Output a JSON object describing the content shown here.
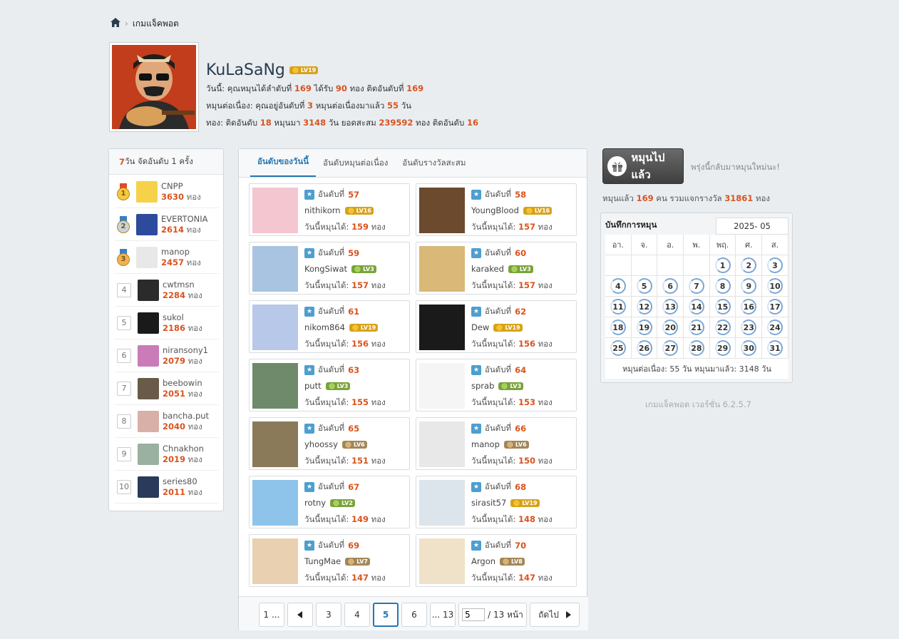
{
  "breadcrumb": {
    "current": "เกมแจ็คพอต"
  },
  "profile": {
    "name": "KuLaSaNg",
    "level": "LV19",
    "line1": {
      "a": "วันนี้: คุณหมุนได้ลำดับที่ ",
      "rank": "169",
      "b": " ได้รับ ",
      "gold": "90",
      "c": " ทอง ติดอันดับที่ ",
      "pos": "169"
    },
    "line2": {
      "a": "หมุนต่อเนื่อง: คุณอยู่อันดับที่ ",
      "rank": "3",
      "b": " หมุนต่อเนื่องมาแล้ว ",
      "days": "55",
      "c": " วัน"
    },
    "line3": {
      "a": "ทอง: ติดอันดับ ",
      "rank": "18",
      "b": " หมุนมา ",
      "days": "3148",
      "c": " วัน ยอดสะสม ",
      "total": "239592",
      "d": " ทอง ติดอันดับ ",
      "pos": "16"
    }
  },
  "weekly": {
    "header_num": "7",
    "header_text": " วัน จัดอันดับ 1 ครั้ง",
    "unit": "ทอง",
    "items": [
      {
        "rank": "1",
        "name": "CNPP",
        "score": "3630"
      },
      {
        "rank": "2",
        "name": "EVERTONIA",
        "score": "2614"
      },
      {
        "rank": "3",
        "name": "manop",
        "score": "2457"
      },
      {
        "rank": "4",
        "name": "cwtmsn",
        "score": "2284"
      },
      {
        "rank": "5",
        "name": "sukol",
        "score": "2186"
      },
      {
        "rank": "6",
        "name": "niransony1",
        "score": "2079"
      },
      {
        "rank": "7",
        "name": "beebowin",
        "score": "2051"
      },
      {
        "rank": "8",
        "name": "bancha.put",
        "score": "2040"
      },
      {
        "rank": "9",
        "name": "Chnakhon",
        "score": "2019"
      },
      {
        "rank": "10",
        "name": "series80",
        "score": "2011"
      }
    ]
  },
  "tabs": [
    "อันดับของวันนี้",
    "อันดับหมุนต่อเนื่อง",
    "อันดับรางวัลสะสม"
  ],
  "card_labels": {
    "rank_prefix": "อันดับที่ ",
    "spin_prefix": "วันนี้หมุนได้: ",
    "unit": " ทอง"
  },
  "cards": [
    {
      "rank": "57",
      "name": "nithikorn",
      "level": "LV16",
      "gold": "159"
    },
    {
      "rank": "58",
      "name": "YoungBlood",
      "level": "LV16",
      "gold": "157"
    },
    {
      "rank": "59",
      "name": "KongSiwat",
      "level": "LV3",
      "gold": "157"
    },
    {
      "rank": "60",
      "name": "karaked",
      "level": "LV3",
      "gold": "157"
    },
    {
      "rank": "61",
      "name": "nikom864",
      "level": "LV19",
      "gold": "156"
    },
    {
      "rank": "62",
      "name": "Dew",
      "level": "LV19",
      "gold": "156"
    },
    {
      "rank": "63",
      "name": "putt",
      "level": "LV3",
      "gold": "155"
    },
    {
      "rank": "64",
      "name": "sprab",
      "level": "LV3",
      "gold": "153"
    },
    {
      "rank": "65",
      "name": "yhoossy",
      "level": "LV6",
      "gold": "151"
    },
    {
      "rank": "66",
      "name": "manop",
      "level": "LV6",
      "gold": "150"
    },
    {
      "rank": "67",
      "name": "rotny",
      "level": "LV2",
      "gold": "149"
    },
    {
      "rank": "68",
      "name": "sirasit57",
      "level": "LV19",
      "gold": "148"
    },
    {
      "rank": "69",
      "name": "TungMae",
      "level": "LV7",
      "gold": "147"
    },
    {
      "rank": "70",
      "name": "Argon",
      "level": "LV8",
      "gold": "147"
    }
  ],
  "pager": {
    "first": "1 ...",
    "p3": "3",
    "p4": "4",
    "p5": "5",
    "p6": "6",
    "last": "... 13",
    "input_value": "5",
    "of_text": "/ 13 หน้า",
    "next": "ถัดไป"
  },
  "spin": {
    "button": "หมุนไปแล้ว",
    "note": "พรุ่งนี้กลับมาหมุนใหม่นะ!",
    "stats_a": "หมุนแล้ว ",
    "count": "169",
    "stats_b": " คน รวมแจกรางวัล ",
    "total": "31861",
    "stats_c": " ทอง"
  },
  "calendar": {
    "title": "บันทึกการหมุน",
    "month": "2025- 05",
    "weekdays": [
      "อา.",
      "จ.",
      "อ.",
      "พ.",
      "พฤ.",
      "ศ.",
      "ส."
    ],
    "footer": "หมุนต่อเนื่อง: 55 วัน หมุนมาแล้ว: 3148 วัน"
  },
  "version": "เกมแจ็คพอต เวอร์ชั่น 6.2.5.7",
  "colors": {
    "accent": "#2577b1",
    "number": "#d9531e",
    "background": "#e9edf0"
  }
}
